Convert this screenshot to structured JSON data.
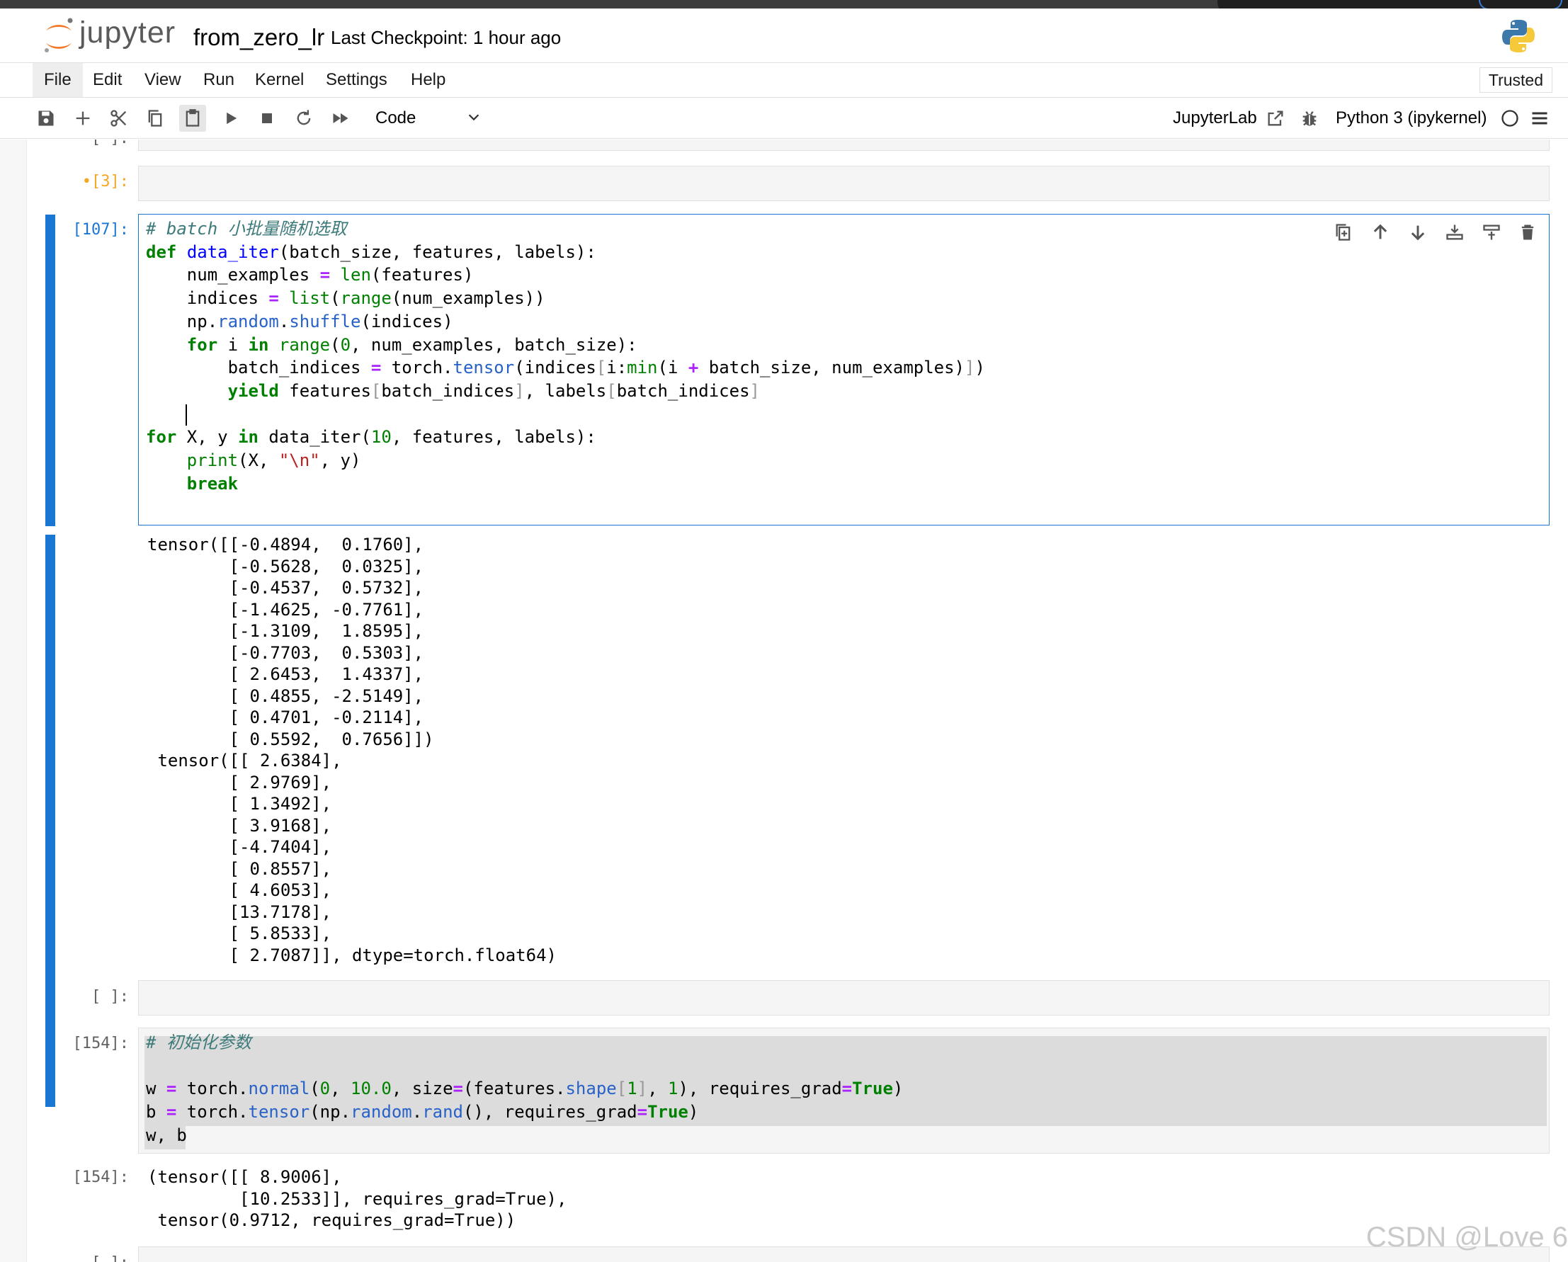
{
  "header": {
    "logo_text": "jupyter",
    "notebook_name": "from_zero_lr",
    "checkpoint": "Last Checkpoint: 1 hour ago"
  },
  "menu": {
    "items": [
      "File",
      "Edit",
      "View",
      "Run",
      "Kernel",
      "Settings",
      "Help"
    ],
    "trusted": "Trusted"
  },
  "toolbar": {
    "cell_type": "Code",
    "jupyterlab": "JupyterLab",
    "kernel": "Python 3 (ipykernel)"
  },
  "cells": {
    "c0": {
      "prompt": "[ ]:"
    },
    "c1": {
      "prompt": "•[3]:"
    },
    "c2": {
      "prompt": "[107]:",
      "output": "tensor([[-0.4894,  0.1760],\n        [-0.5628,  0.0325],\n        [-0.4537,  0.5732],\n        [-1.4625, -0.7761],\n        [-1.3109,  1.8595],\n        [-0.7703,  0.5303],\n        [ 2.6453,  1.4337],\n        [ 0.4855, -2.5149],\n        [ 0.4701, -0.2114],\n        [ 0.5592,  0.7656]])\n tensor([[ 2.6384],\n        [ 2.9769],\n        [ 1.3492],\n        [ 3.9168],\n        [-4.7404],\n        [ 0.8557],\n        [ 4.6053],\n        [13.7178],\n        [ 5.8533],\n        [ 2.7087]], dtype=torch.float64)"
    },
    "c3": {
      "prompt": "[ ]:"
    },
    "c4": {
      "prompt": "[154]:",
      "out_prompt": "[154]:",
      "output": "(tensor([[ 8.9006],\n         [10.2533]], requires_grad=True),\n tensor(0.9712, requires_grad=True))"
    },
    "c5": {
      "prompt": "[ ]:"
    }
  },
  "watermark": "CSDN @Love 6",
  "colors": {
    "accent": "#1976d2",
    "dirty": "#f5a623",
    "keyword": "#008000",
    "function": "#0000ff",
    "string": "#ba2121",
    "operator": "#aa22ff"
  }
}
